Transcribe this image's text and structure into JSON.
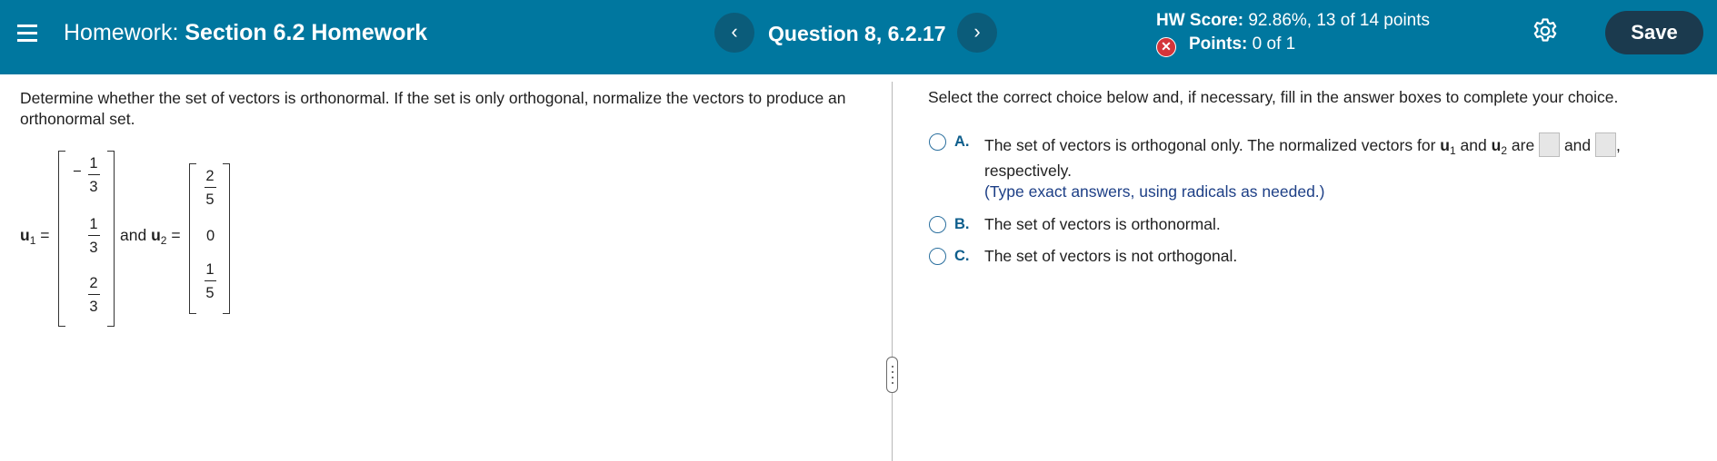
{
  "header": {
    "title_prefix": "Homework:",
    "title_name": "Section 6.2 Homework",
    "question_label": "Question 8, 6.2.17",
    "prev_glyph": "‹",
    "next_glyph": "›",
    "score_label": "HW Score:",
    "score_value": "92.86%, 13 of 14 points",
    "points_label": "Points:",
    "points_value": "0 of 1",
    "save_label": "Save",
    "icons": [
      "menu-icon",
      "chevron-left-icon",
      "chevron-right-icon",
      "incorrect-x-icon",
      "gear-icon"
    ]
  },
  "problem": {
    "prompt": "Determine whether the set of vectors is orthonormal. If the set is only orthogonal, normalize the vectors to produce an orthonormal set.",
    "u1_label": "u",
    "u1_sub": "1",
    "u2_label": "u",
    "u2_sub": "2",
    "equals": "=",
    "and_text": "and",
    "u1_entries": [
      {
        "sign": "−",
        "num": "1",
        "den": "3"
      },
      {
        "sign": "",
        "num": "1",
        "den": "3"
      },
      {
        "sign": "",
        "num": "2",
        "den": "3"
      }
    ],
    "u2_entries": [
      {
        "num": "2",
        "den": "5"
      },
      {
        "value": "0"
      },
      {
        "num": "1",
        "den": "5"
      }
    ]
  },
  "answer": {
    "instruction": "Select the correct choice below and, if necessary, fill in the answer boxes to complete your choice.",
    "choices": [
      {
        "letter": "A.",
        "text_start": "The set of vectors is orthogonal only. The normalized vectors for",
        "u": "u",
        "sub1": "1",
        "and_text": "and",
        "sub2": "2",
        "are_text": "are",
        "comma": ",",
        "line2": "respectively.",
        "hint": "(Type exact answers, using radicals as needed.)"
      },
      {
        "letter": "B.",
        "text": "The set of vectors is orthonormal."
      },
      {
        "letter": "C.",
        "text": "The set of vectors is not orthogonal."
      }
    ]
  },
  "colors": {
    "header_bg": "#00779f",
    "nav_button_bg": "#0b5c7a",
    "save_button_bg": "#1b3a4e",
    "incorrect_badge": "#d4353a",
    "choice_letter": "#0e5e8c",
    "hint_text": "#1d3f86"
  }
}
